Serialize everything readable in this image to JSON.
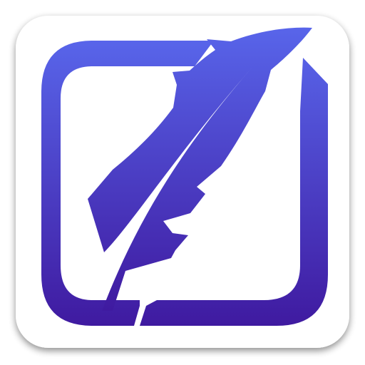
{
  "app_icon": {
    "icon": "feather-quill-icon",
    "frame_icon": "rounded-square-frame-icon",
    "colors": {
      "tile_background": "#ffffff",
      "gradient_top": "#5865ea",
      "gradient_bottom": "#3f1aa0",
      "tile_shadow": "#9a9a9a"
    }
  }
}
